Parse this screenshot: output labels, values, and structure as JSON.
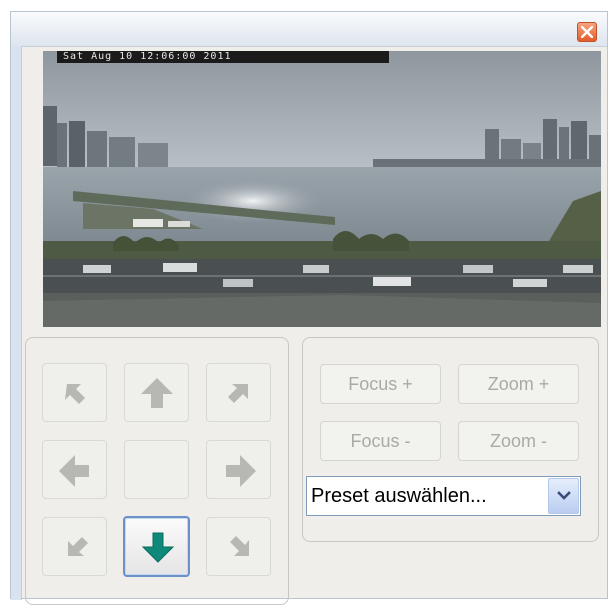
{
  "window": {
    "close_icon": "close-icon"
  },
  "camera": {
    "timestamp": "Sat Aug 10 12:06:00 2011"
  },
  "ptz": {
    "buttons": [
      {
        "name": "pan-up-left-button",
        "icon": "arrow-up-left-icon"
      },
      {
        "name": "pan-up-button",
        "icon": "arrow-up-icon"
      },
      {
        "name": "pan-up-right-button",
        "icon": "arrow-up-right-icon"
      },
      {
        "name": "pan-left-button",
        "icon": "arrow-left-icon"
      },
      {
        "name": "pan-home-button",
        "icon": ""
      },
      {
        "name": "pan-right-button",
        "icon": "arrow-right-icon"
      },
      {
        "name": "pan-down-left-button",
        "icon": "arrow-down-left-icon"
      },
      {
        "name": "pan-down-button",
        "icon": "arrow-down-icon",
        "active": true
      },
      {
        "name": "pan-down-right-button",
        "icon": "arrow-down-right-icon"
      }
    ]
  },
  "lens": {
    "focus_plus": "Focus +",
    "zoom_plus": "Zoom +",
    "focus_minus": "Focus -",
    "zoom_minus": "Zoom -"
  },
  "preset": {
    "selected": "Preset auswählen..."
  },
  "colors": {
    "arrow_disabled": "#b7b7b4",
    "arrow_active": "#0f8a7a",
    "select_border": "#7f9db9"
  }
}
